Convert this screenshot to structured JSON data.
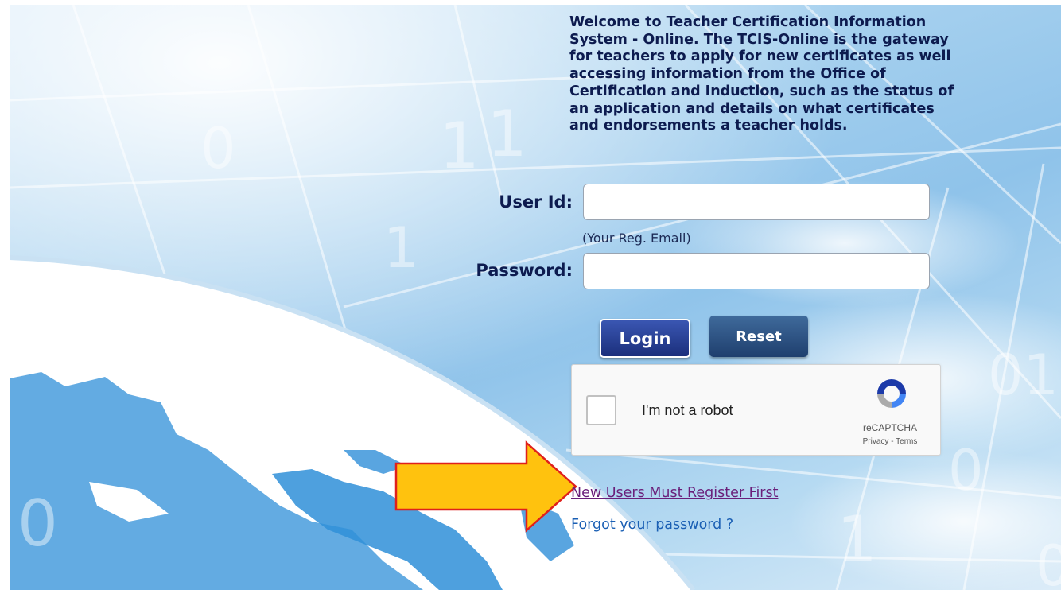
{
  "welcome": {
    "lines": [
      "Welcome to Teacher Certification Information",
      "System - Online. The TCIS-Online is the gateway",
      "for teachers to apply for new certificates as well",
      "accessing information from the Office of",
      "Certification and Induction, such as the status of",
      "an application and details on what certificates",
      "and endorsements a teacher holds."
    ]
  },
  "login_form": {
    "user_id_label": "User Id:",
    "user_id_value": "",
    "user_id_hint": "(Your Reg. Email)",
    "password_label": "Password:",
    "password_value": "",
    "login_button": "Login",
    "reset_button": "Reset"
  },
  "captcha": {
    "label": "I'm not a robot",
    "brand": "reCAPTCHA",
    "links": "Privacy - Terms",
    "checked": false
  },
  "links": {
    "register": "New Users Must Register First",
    "forgot_password": "Forgot your password ?"
  },
  "background": {
    "digits": [
      "0",
      "1",
      "1",
      "1",
      "0",
      "01",
      "0",
      "1",
      "0",
      "0",
      "0"
    ]
  },
  "colors": {
    "text_navy": "#0d1b4f",
    "login_blue": "#1b2f7c",
    "arrow_fill": "#ffc20e",
    "arrow_stroke": "#e0201b",
    "register_link": "#6a1f7a",
    "forgot_link": "#1a5fb4"
  }
}
